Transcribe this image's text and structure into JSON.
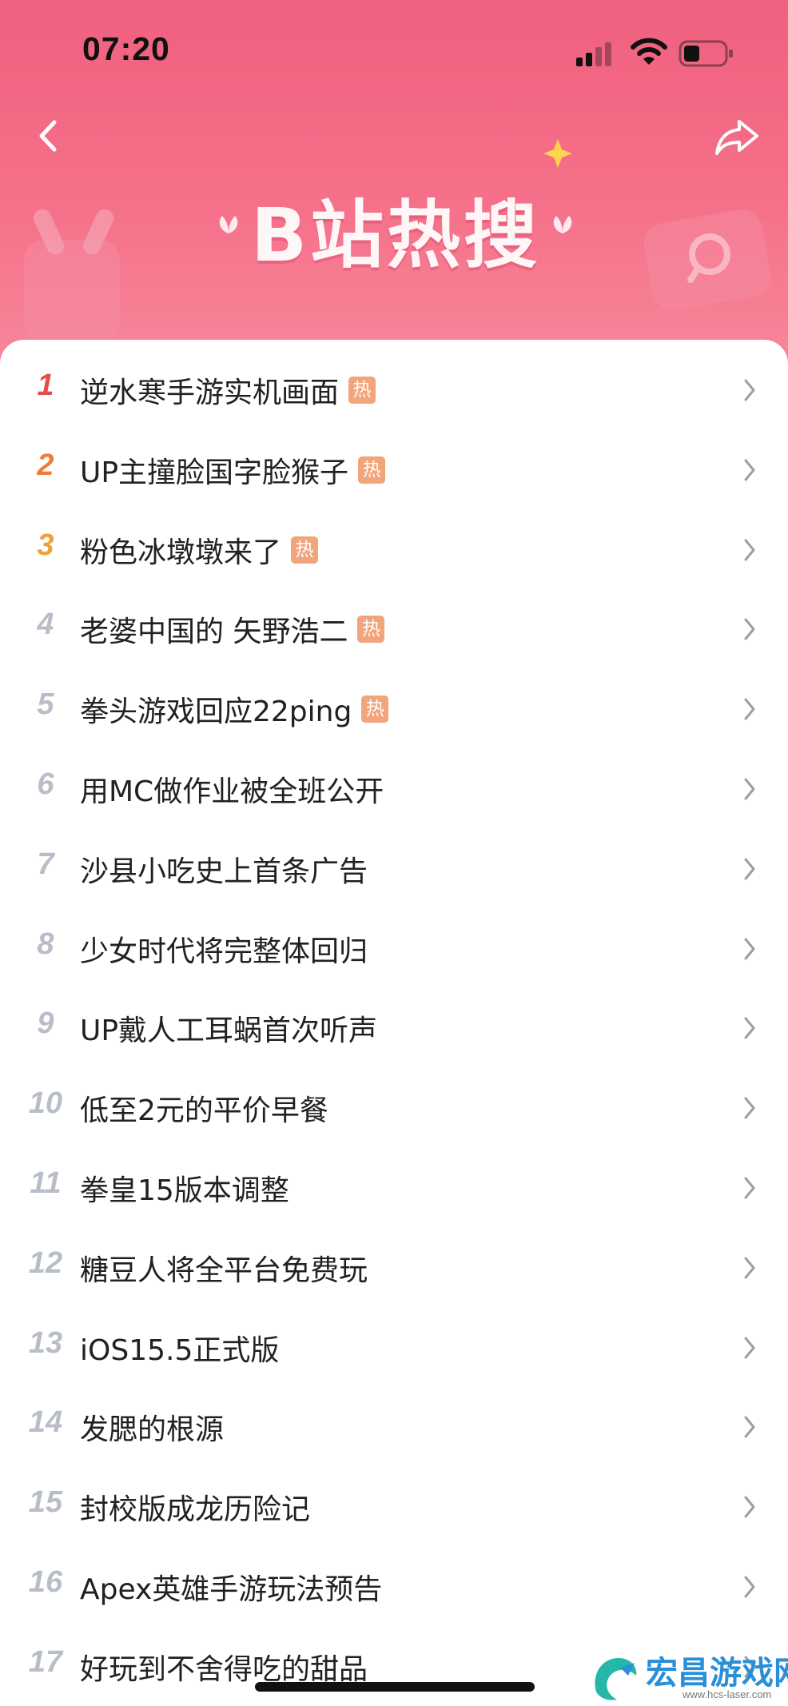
{
  "status_bar": {
    "time": "07:20"
  },
  "header": {
    "title": "B站热搜"
  },
  "hot_badge_label": "热",
  "items": [
    {
      "rank": "1",
      "title": "逆水寒手游实机画面",
      "hot": true
    },
    {
      "rank": "2",
      "title": "UP主撞脸国字脸猴子",
      "hot": true
    },
    {
      "rank": "3",
      "title": "粉色冰墩墩来了",
      "hot": true
    },
    {
      "rank": "4",
      "title": "老婆中国的 矢野浩二",
      "hot": true
    },
    {
      "rank": "5",
      "title": "拳头游戏回应22ping",
      "hot": true
    },
    {
      "rank": "6",
      "title": "用MC做作业被全班公开",
      "hot": false
    },
    {
      "rank": "7",
      "title": "沙县小吃史上首条广告",
      "hot": false
    },
    {
      "rank": "8",
      "title": "少女时代将完整体回归",
      "hot": false
    },
    {
      "rank": "9",
      "title": "UP戴人工耳蜗首次听声",
      "hot": false
    },
    {
      "rank": "10",
      "title": "低至2元的平价早餐",
      "hot": false
    },
    {
      "rank": "11",
      "title": "拳皇15版本调整",
      "hot": false
    },
    {
      "rank": "12",
      "title": "糖豆人将全平台免费玩",
      "hot": false
    },
    {
      "rank": "13",
      "title": "iOS15.5正式版",
      "hot": false
    },
    {
      "rank": "14",
      "title": "发腮的根源",
      "hot": false
    },
    {
      "rank": "15",
      "title": "封校版成龙历险记",
      "hot": false
    },
    {
      "rank": "16",
      "title": "Apex英雄手游玩法预告",
      "hot": false
    },
    {
      "rank": "17",
      "title": "好玩到不舍得吃的甜品",
      "hot": false
    }
  ],
  "watermark": {
    "text": "宏昌游戏网",
    "url": "www.hcs-laser.com"
  },
  "colors": {
    "header_pink": "#f0607f",
    "rank1": "#e24e4a",
    "rank2": "#ef7d3a",
    "rank3": "#f0a23a",
    "rank_other": "#b8bec8",
    "hot_badge": "#f2a57b"
  },
  "icons": [
    "back-arrow-icon",
    "share-icon",
    "chevron-right-icon",
    "signal-icon",
    "wifi-icon",
    "battery-icon",
    "star-icon"
  ]
}
